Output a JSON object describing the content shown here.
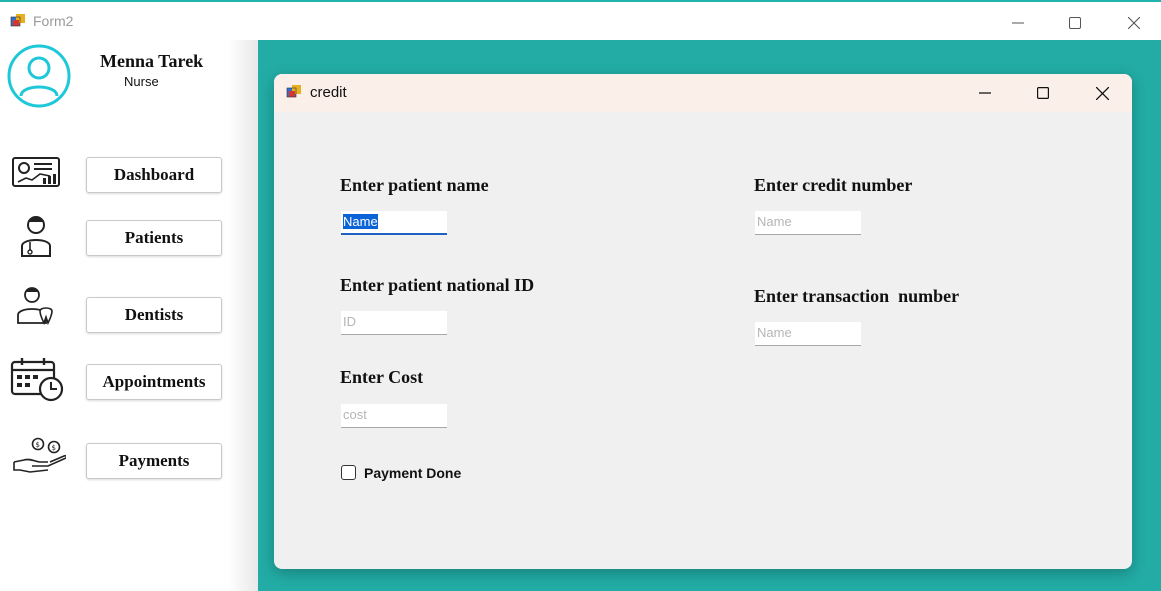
{
  "window": {
    "title": "Form2",
    "app_icon": "winforms-app-icon",
    "controls": [
      "minimize-icon",
      "maximize-icon",
      "close-icon"
    ]
  },
  "sidebar": {
    "user": {
      "name": "Menna Tarek",
      "role": "Nurse",
      "avatar_icon": "user-avatar-icon"
    },
    "items": [
      {
        "label": "Dashboard",
        "icon": "dashboard-icon"
      },
      {
        "label": "Patients",
        "icon": "patient-icon"
      },
      {
        "label": "Dentists",
        "icon": "dentist-icon"
      },
      {
        "label": "Appointments",
        "icon": "calendar-clock-icon"
      },
      {
        "label": "Payments",
        "icon": "payment-hand-icon"
      }
    ]
  },
  "dialog": {
    "title": "credit",
    "fields": {
      "patient_name": {
        "label": "Enter patient name",
        "value": "Name",
        "selected": true
      },
      "national_id": {
        "label": "Enter patient national ID",
        "placeholder": "ID"
      },
      "cost": {
        "label": "Enter Cost",
        "placeholder": "cost"
      },
      "credit_number": {
        "label": "Enter credit number",
        "placeholder": "Name"
      },
      "transaction_number": {
        "label": "Enter transaction  number",
        "placeholder": "Name"
      }
    },
    "payment_done": {
      "label": "Payment Done",
      "checked": false
    }
  },
  "colors": {
    "accent_teal": "#22aca5",
    "dialog_bg": "#f0f0f0",
    "dialog_title_bg": "#fbefe9",
    "avatar_cyan": "#1ec8d8",
    "selection_blue": "#0a64d8"
  }
}
